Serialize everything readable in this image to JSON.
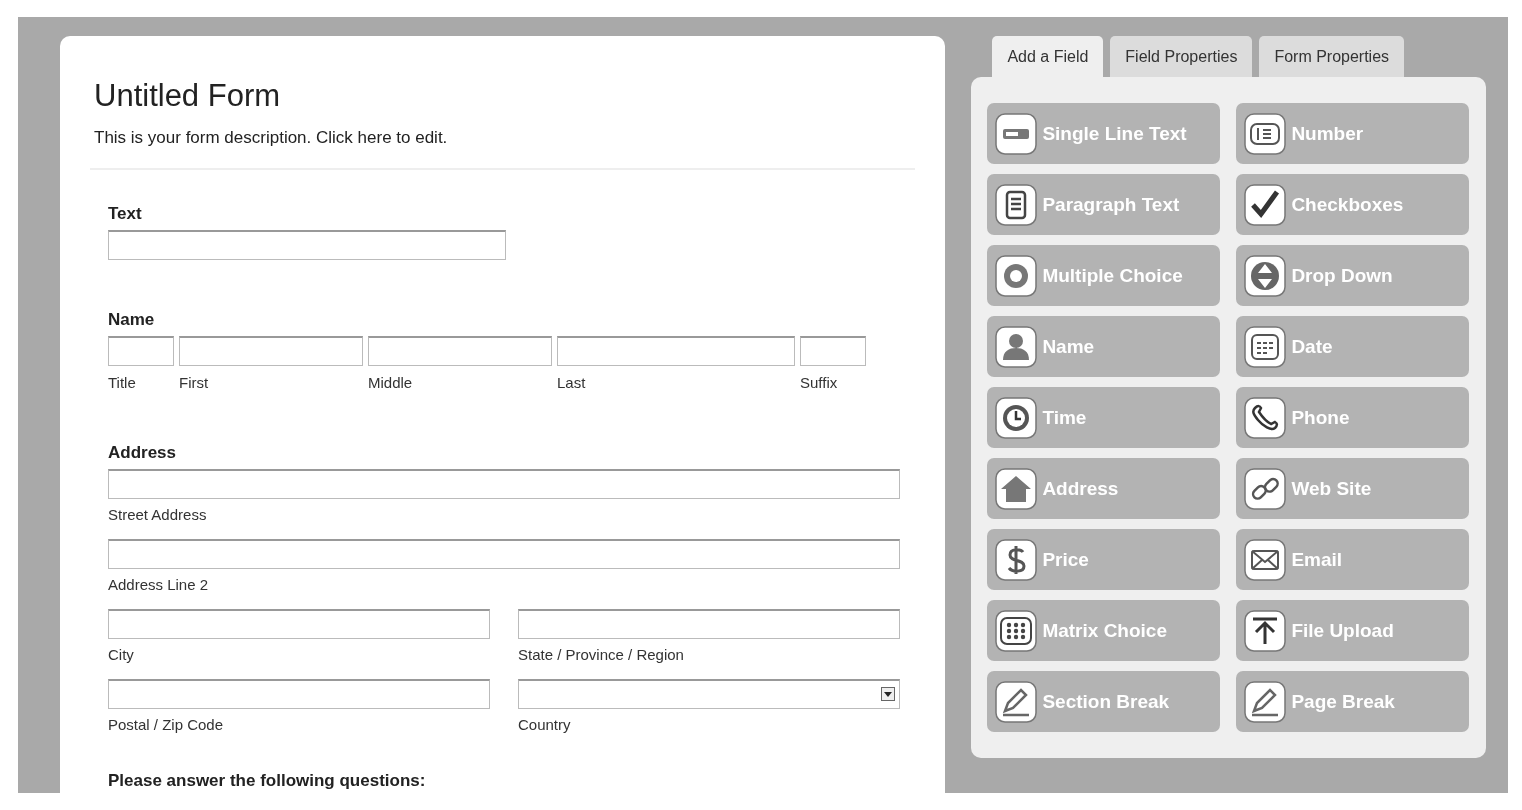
{
  "form": {
    "title": "Untitled Form",
    "description": "This is your form description. Click here to edit.",
    "fields": [
      {
        "kind": "text",
        "label": "Text"
      },
      {
        "kind": "name",
        "label": "Name",
        "parts": [
          {
            "label": "Title"
          },
          {
            "label": "First"
          },
          {
            "label": "Middle"
          },
          {
            "label": "Last"
          },
          {
            "label": "Suffix"
          }
        ]
      },
      {
        "kind": "address",
        "label": "Address",
        "parts": [
          {
            "label": "Street Address",
            "kind": "input"
          },
          {
            "label": "Address Line 2",
            "kind": "input"
          },
          {
            "label": "City",
            "kind": "input"
          },
          {
            "label": "State / Province / Region",
            "kind": "input"
          },
          {
            "label": "Postal / Zip Code",
            "kind": "input"
          },
          {
            "label": "Country",
            "kind": "select"
          }
        ]
      },
      {
        "kind": "section",
        "label": "Please answer the following questions:"
      }
    ]
  },
  "tabs": [
    {
      "label": "Add a Field",
      "selected": true
    },
    {
      "label": "Field Properties",
      "selected": false
    },
    {
      "label": "Form Properties",
      "selected": false
    }
  ],
  "palette": [
    {
      "label": "Single Line Text"
    },
    {
      "label": "Number"
    },
    {
      "label": "Paragraph Text"
    },
    {
      "label": "Checkboxes"
    },
    {
      "label": "Multiple Choice"
    },
    {
      "label": "Drop Down"
    },
    {
      "label": "Name"
    },
    {
      "label": "Date"
    },
    {
      "label": "Time"
    },
    {
      "label": "Phone"
    },
    {
      "label": "Address"
    },
    {
      "label": "Web Site"
    },
    {
      "label": "Price"
    },
    {
      "label": "Email"
    },
    {
      "label": "Matrix Choice"
    },
    {
      "label": "File Upload"
    },
    {
      "label": "Section Break"
    },
    {
      "label": "Page Break"
    }
  ]
}
